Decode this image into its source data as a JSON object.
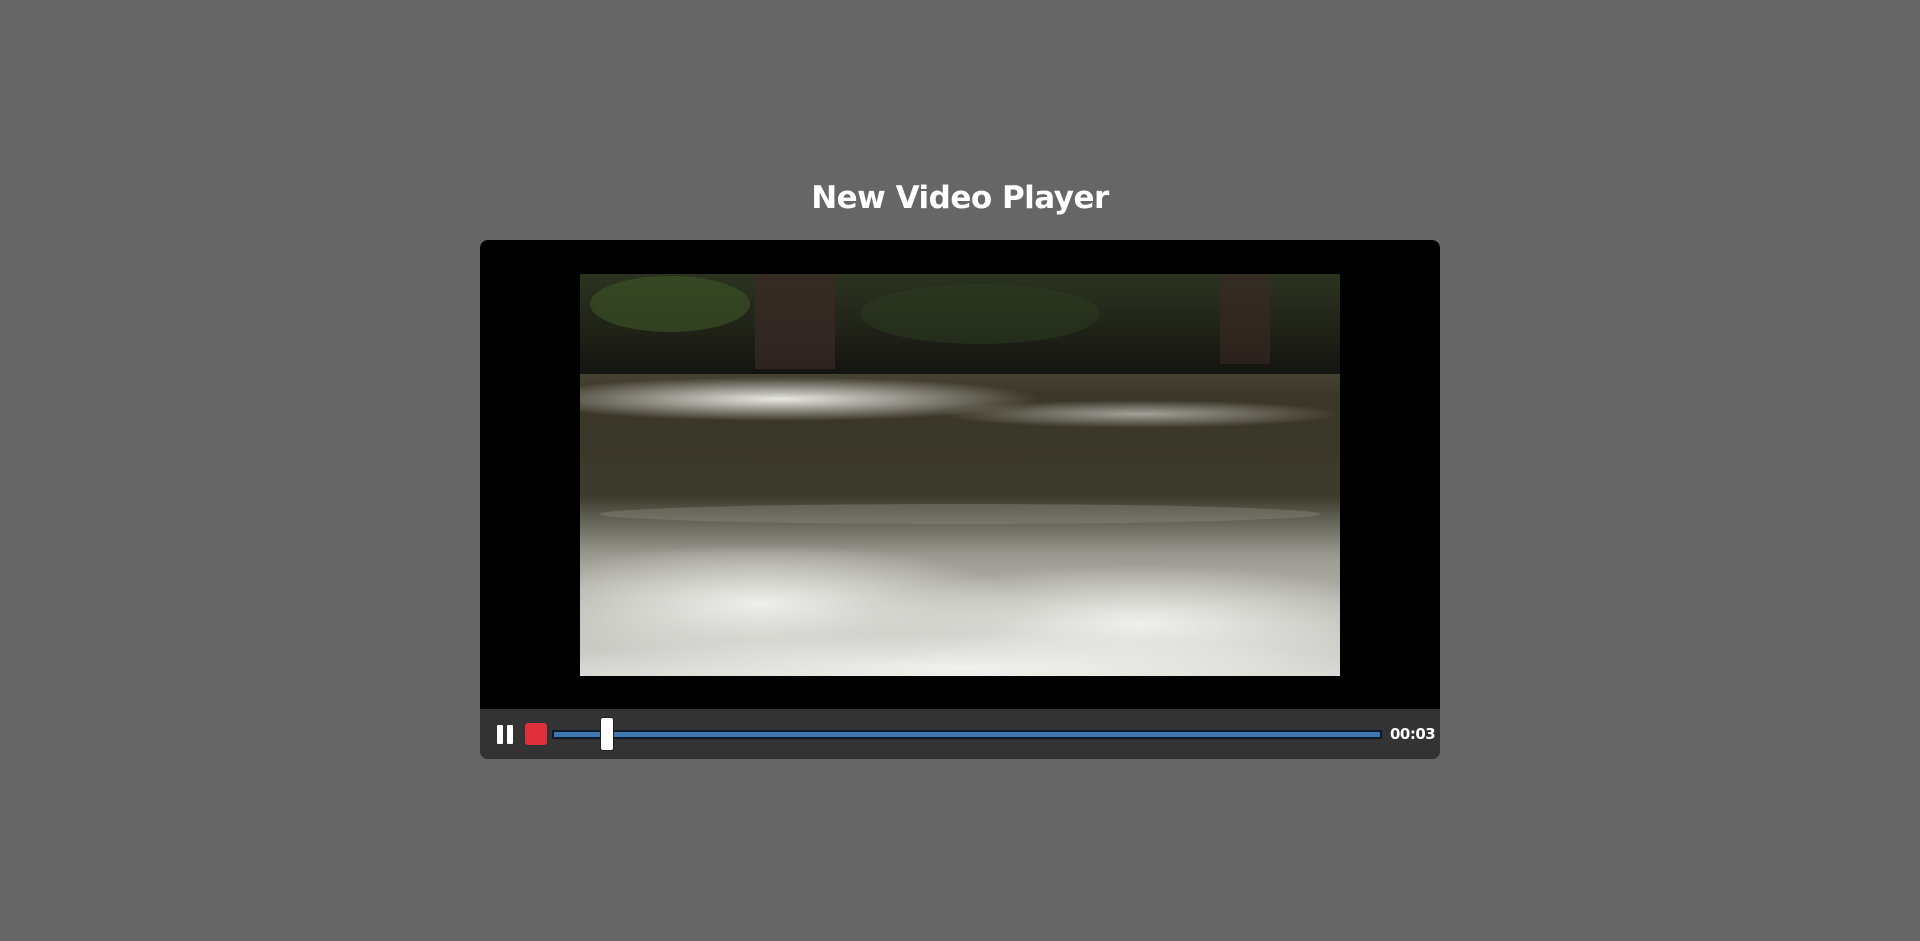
{
  "page": {
    "title": "New Video Player"
  },
  "player": {
    "current_time": "00:03",
    "progress": 0.066,
    "colors": {
      "background": "#666666",
      "player_bg": "#000000",
      "controls_bg": "#333333",
      "seek_fill": "#3f76ae",
      "stop_button": "#e0303c"
    },
    "icons": {
      "pause": "pause-icon",
      "stop": "stop-icon"
    }
  }
}
